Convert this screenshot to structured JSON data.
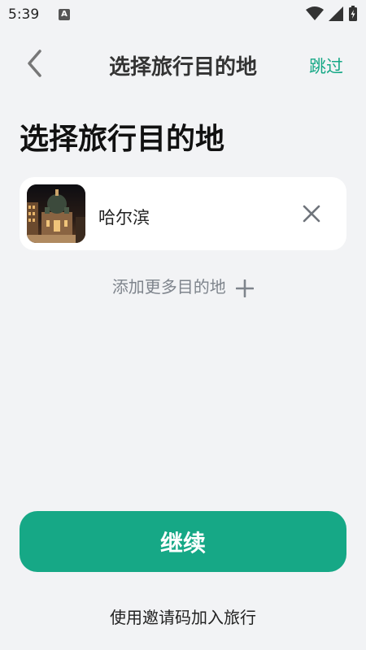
{
  "status_bar": {
    "time": "5:39",
    "notification_badge": "A",
    "icons": [
      "wifi-icon",
      "signal-icon",
      "battery-charging-icon"
    ]
  },
  "header": {
    "title": "选择旅行目的地",
    "skip_label": "跳过",
    "back_icon": "chevron-left-icon"
  },
  "page": {
    "title": "选择旅行目的地"
  },
  "destinations": [
    {
      "name": "哈尔滨",
      "remove_icon": "close-icon"
    }
  ],
  "add_more": {
    "label": "添加更多目的地",
    "icon": "plus-icon"
  },
  "actions": {
    "continue_label": "继续",
    "invite_label": "使用邀请码加入旅行"
  },
  "colors": {
    "accent": "#16A886",
    "background": "#F2F3F5",
    "card": "#FFFFFF",
    "muted_text": "#7E848C"
  }
}
